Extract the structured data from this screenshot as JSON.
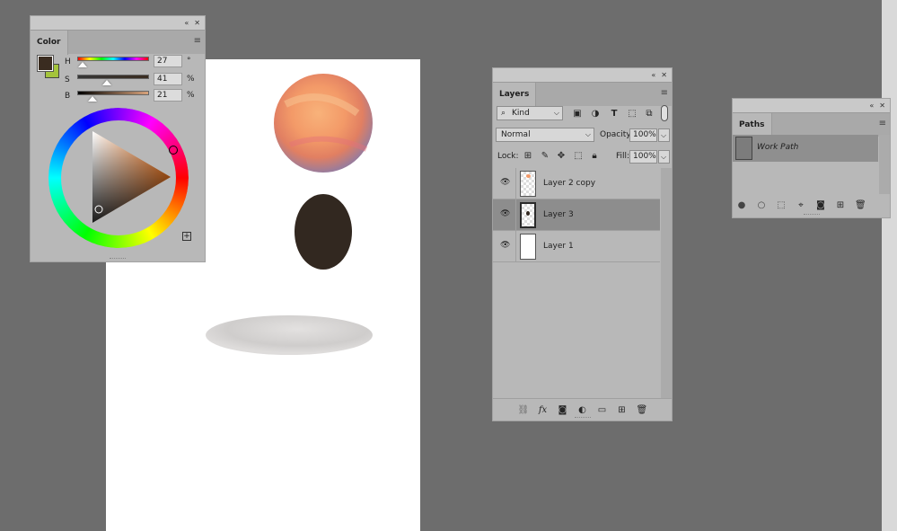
{
  "color_panel": {
    "title": "Color",
    "h": {
      "label": "H",
      "value": "27",
      "unit": "°"
    },
    "s": {
      "label": "S",
      "value": "41",
      "unit": "%"
    },
    "b": {
      "label": "B",
      "value": "21",
      "unit": "%"
    },
    "foreground": "#3a2c20",
    "background": "#a4c43c",
    "icons": [
      "collapse-icon",
      "close-icon",
      "panel-menu-icon",
      "add-swatch-icon"
    ]
  },
  "layers_panel": {
    "title": "Layers",
    "filter_kind": "Kind",
    "blend_mode": "Normal",
    "opacity_label": "Opacity:",
    "opacity_value": "100%",
    "lock_label": "Lock:",
    "fill_label": "Fill:",
    "fill_value": "100%",
    "layers": [
      {
        "name": "Layer 2 copy",
        "visible": true,
        "selected": false
      },
      {
        "name": "Layer 3",
        "visible": true,
        "selected": true
      },
      {
        "name": "Layer 1",
        "visible": true,
        "selected": false
      }
    ],
    "bottom_icons": [
      "link-icon",
      "fx-icon",
      "mask-icon",
      "adjustment-icon",
      "folder-icon",
      "new-layer-icon",
      "trash-icon"
    ],
    "bottom_fx": "fx"
  },
  "paths_panel": {
    "title": "Paths",
    "paths": [
      {
        "name": "Work Path",
        "selected": true
      }
    ],
    "bottom_icons": [
      "fill-path-icon",
      "stroke-path-icon",
      "selection-icon",
      "make-path-icon",
      "mask-icon",
      "new-path-icon",
      "trash-icon"
    ]
  },
  "canvas": {
    "background": "#ffffff",
    "sphere_colors": [
      "#f7a36a",
      "#e87a55",
      "#c98faa"
    ],
    "ellipse_color": "#322820",
    "shadow_color": "#c8c6c5"
  }
}
